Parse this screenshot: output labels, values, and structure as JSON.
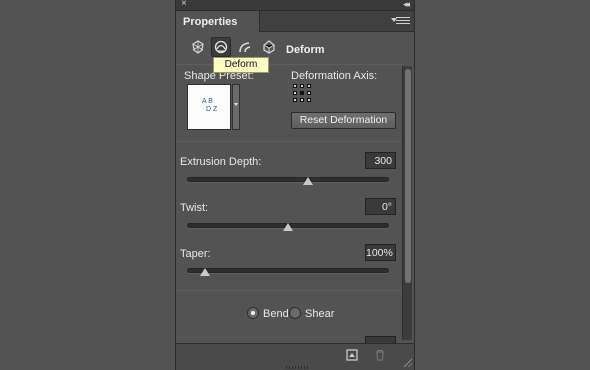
{
  "panel": {
    "tab_label": "Properties",
    "mode_title": "Deform",
    "tooltip": "Deform"
  },
  "icons": {
    "close": "close-icon",
    "collapse": "double-chevron-icon",
    "menu": "panel-menu-icon",
    "modes": [
      "mesh-icon",
      "deform-icon",
      "cap-icon",
      "coordinates-icon"
    ],
    "footer": [
      "render-icon",
      "trash-icon"
    ]
  },
  "deform": {
    "shape_preset_label": "Shape Preset:",
    "preset_thumb_line1": "A B",
    "preset_thumb_line2": "D Z",
    "axis_label": "Deformation Axis:",
    "reset_label": "Reset Deformation",
    "extrusion_label": "Extrusion Depth:",
    "extrusion_value": "300",
    "extrusion_fraction": 0.6,
    "twist_label": "Twist:",
    "twist_value": "0°",
    "twist_fraction": 0.5,
    "taper_label": "Taper:",
    "taper_value": "100%",
    "taper_fraction": 0.09,
    "bend_label": "Bend",
    "shear_label": "Shear",
    "selected_mode": "Bend"
  },
  "colors": {
    "background": "#535353",
    "tooltip_bg": "#fdfdc3",
    "preset_text": "#2b5d8a"
  }
}
